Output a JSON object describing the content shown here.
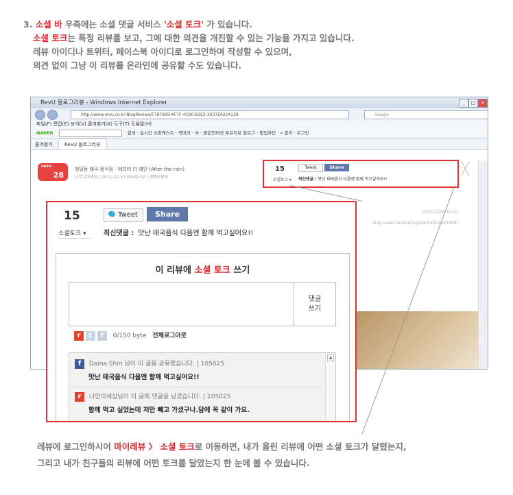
{
  "intro": {
    "num": "3.",
    "bar_label": "소셜 바",
    "line1_mid": " 우측에는 소셜 댓글 서비스 ",
    "quoted": "'소셜 토크'",
    "line1_end": " 가 있습니다.",
    "talk_label": "소셜 토크",
    "line2_rest": "는 특정 리뷰를 보고, 그에 대한 의견을 개진할 수 있는 기능을 가지고 있습니다.",
    "line3": "레뷰 아이디나 트위터, 페이스북 아이디로 로그인하여 작성할 수 있으며,",
    "line4": "의견 없이 그냥 이 리뷰를 온라인에 공유할 수도 있습니다."
  },
  "browser": {
    "window_title": "RevU 블로그리뷰 - Windows Internet Explorer",
    "url": "http://www.revu.co.kr/BlogReview/F787829-AF7F-4C90-B3E2-3937E0234138",
    "search_placeholder": "Google",
    "menu": "파일(F)   편집(E)   보기(V)   즐겨찾기(A)   도구(T)   도움말(H)",
    "toolbar_naver": "NAVER",
    "toolbar_items": "검색 ·  실시간  오존캐스트 · 북마크 ·  사 ·  클린인터넷  무료치료  블로그 ·  팝업차단 · »  관리 ·  로그인",
    "favorites": "즐겨찾기",
    "tab_title": "RevU 블로그리뷰",
    "brand": "revu",
    "brand_num": "28",
    "post_title": "청담동 태국 음식점 - 에프터 더 레인 (After the rain)",
    "post_sub": "나무너머세상  |  2011-12-15 09:42:32  |  여행리뷰동",
    "post_date": "2011/12/09 01:12",
    "post_url": "blog.naver.com/colinyheart/30125250467",
    "close": "╳",
    "mini": {
      "count": "15",
      "label": "소셜토크 ▾",
      "tweet": "Tweet",
      "share": "Share",
      "latest_label": "최신댓글 :",
      "latest_text": "맛난 태국음식 다음엔 함께 먹고싶어요!!"
    }
  },
  "panel": {
    "count": "15",
    "label": "소셜토크 ▾",
    "tweet": "Tweet",
    "share": "Share",
    "latest_label": "최신댓글 :",
    "latest_text": "맛난 태국음식 다음엔 함께 먹고싶어요!!",
    "write_title_pre": "이 리뷰에 ",
    "write_title_red": "소셜 토크",
    "write_title_post": " 쓰기",
    "submit_line1": "댓글",
    "submit_line2": "쓰기",
    "bytes": "0/150 byte",
    "logout": "전체로그아웃",
    "comments": [
      {
        "author": "Daina Shin 님이 이 글을 공유했습니다.",
        "time": "105025",
        "text": "맛난 태국음식 다음엔 함께 먹고싶어요!!"
      },
      {
        "author": "나만의세상님이 이 글에 댓글을 남겼습니다.",
        "time": "105025",
        "text": "함께 먹고 싶었는데 저만 빼고 가셨구나.담에 꼭 같이 가요."
      }
    ]
  },
  "outro": {
    "line1_pre": "레뷰에 로그인하시어 ",
    "line1_red": "마이레뷰 〉 소셜 토크",
    "line1_post": "로 이동하면, 내가 올린 리뷰에 어떤 소셜 토크가 달렸는지,",
    "line2": "그리고 내가 친구들의 리뷰에 어떤 토크를 달았는지 한 눈에 볼 수 있습니다."
  },
  "colors": {
    "accent": "#d8262b",
    "share_blue": "#5f78ab",
    "revu_red": "#e6423e"
  }
}
